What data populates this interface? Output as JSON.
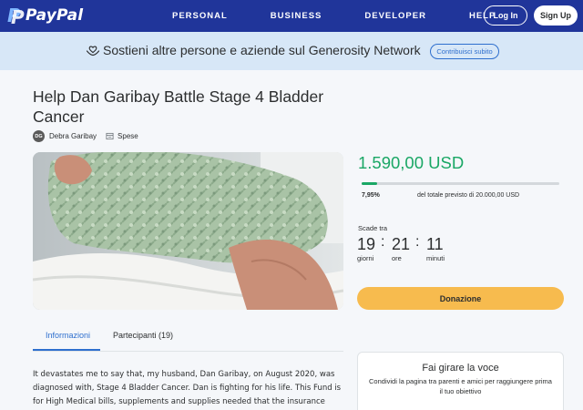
{
  "nav": {
    "logo_text": "PayPal",
    "items": [
      "PERSONAL",
      "BUSINESS",
      "DEVELOPER",
      "HELP"
    ],
    "login_label": "Log In",
    "signup_label": "Sign Up"
  },
  "banner": {
    "icon": "heart-hands-icon",
    "text": "Sostieni altre persone e aziende sul Generosity Network",
    "button_label": "Contribuisci subito"
  },
  "campaign": {
    "title": "Help Dan Garibay Battle Stage 4 Bladder Cancer",
    "organizer_initials": "DG",
    "organizer_name": "Debra Garibay",
    "category": "Spese"
  },
  "funding": {
    "amount": "1.590,00 USD",
    "percent_label": "7,95%",
    "progress_percent": 7.95,
    "goal_text": "del totale previsto di 20.000,00 USD",
    "deadline_label": "Scade tra",
    "countdown": [
      {
        "value": "19",
        "unit": "giorni"
      },
      {
        "value": "21",
        "unit": "ore"
      },
      {
        "value": "11",
        "unit": "minuti"
      }
    ],
    "donate_label": "Donazione",
    "accent_color": "#1aa765",
    "donate_color": "#f7bb4e"
  },
  "tabs": [
    {
      "label": "Informazioni",
      "active": true
    },
    {
      "label": "Partecipanti (19)",
      "active": false
    }
  ],
  "story": {
    "text": "It devastates me to say that, my husband, Dan Garibay, on August 2020, was diagnosed with, Stage 4 Bladder Cancer. Dan is fighting for his life. This Fund is for High Medical bills, supplements and supplies needed that the insurance does not"
  },
  "share": {
    "title": "Fai girare la voce",
    "subtitle": "Condividi la pagina tra parenti e amici per raggiungere prima il tuo obiettivo"
  }
}
